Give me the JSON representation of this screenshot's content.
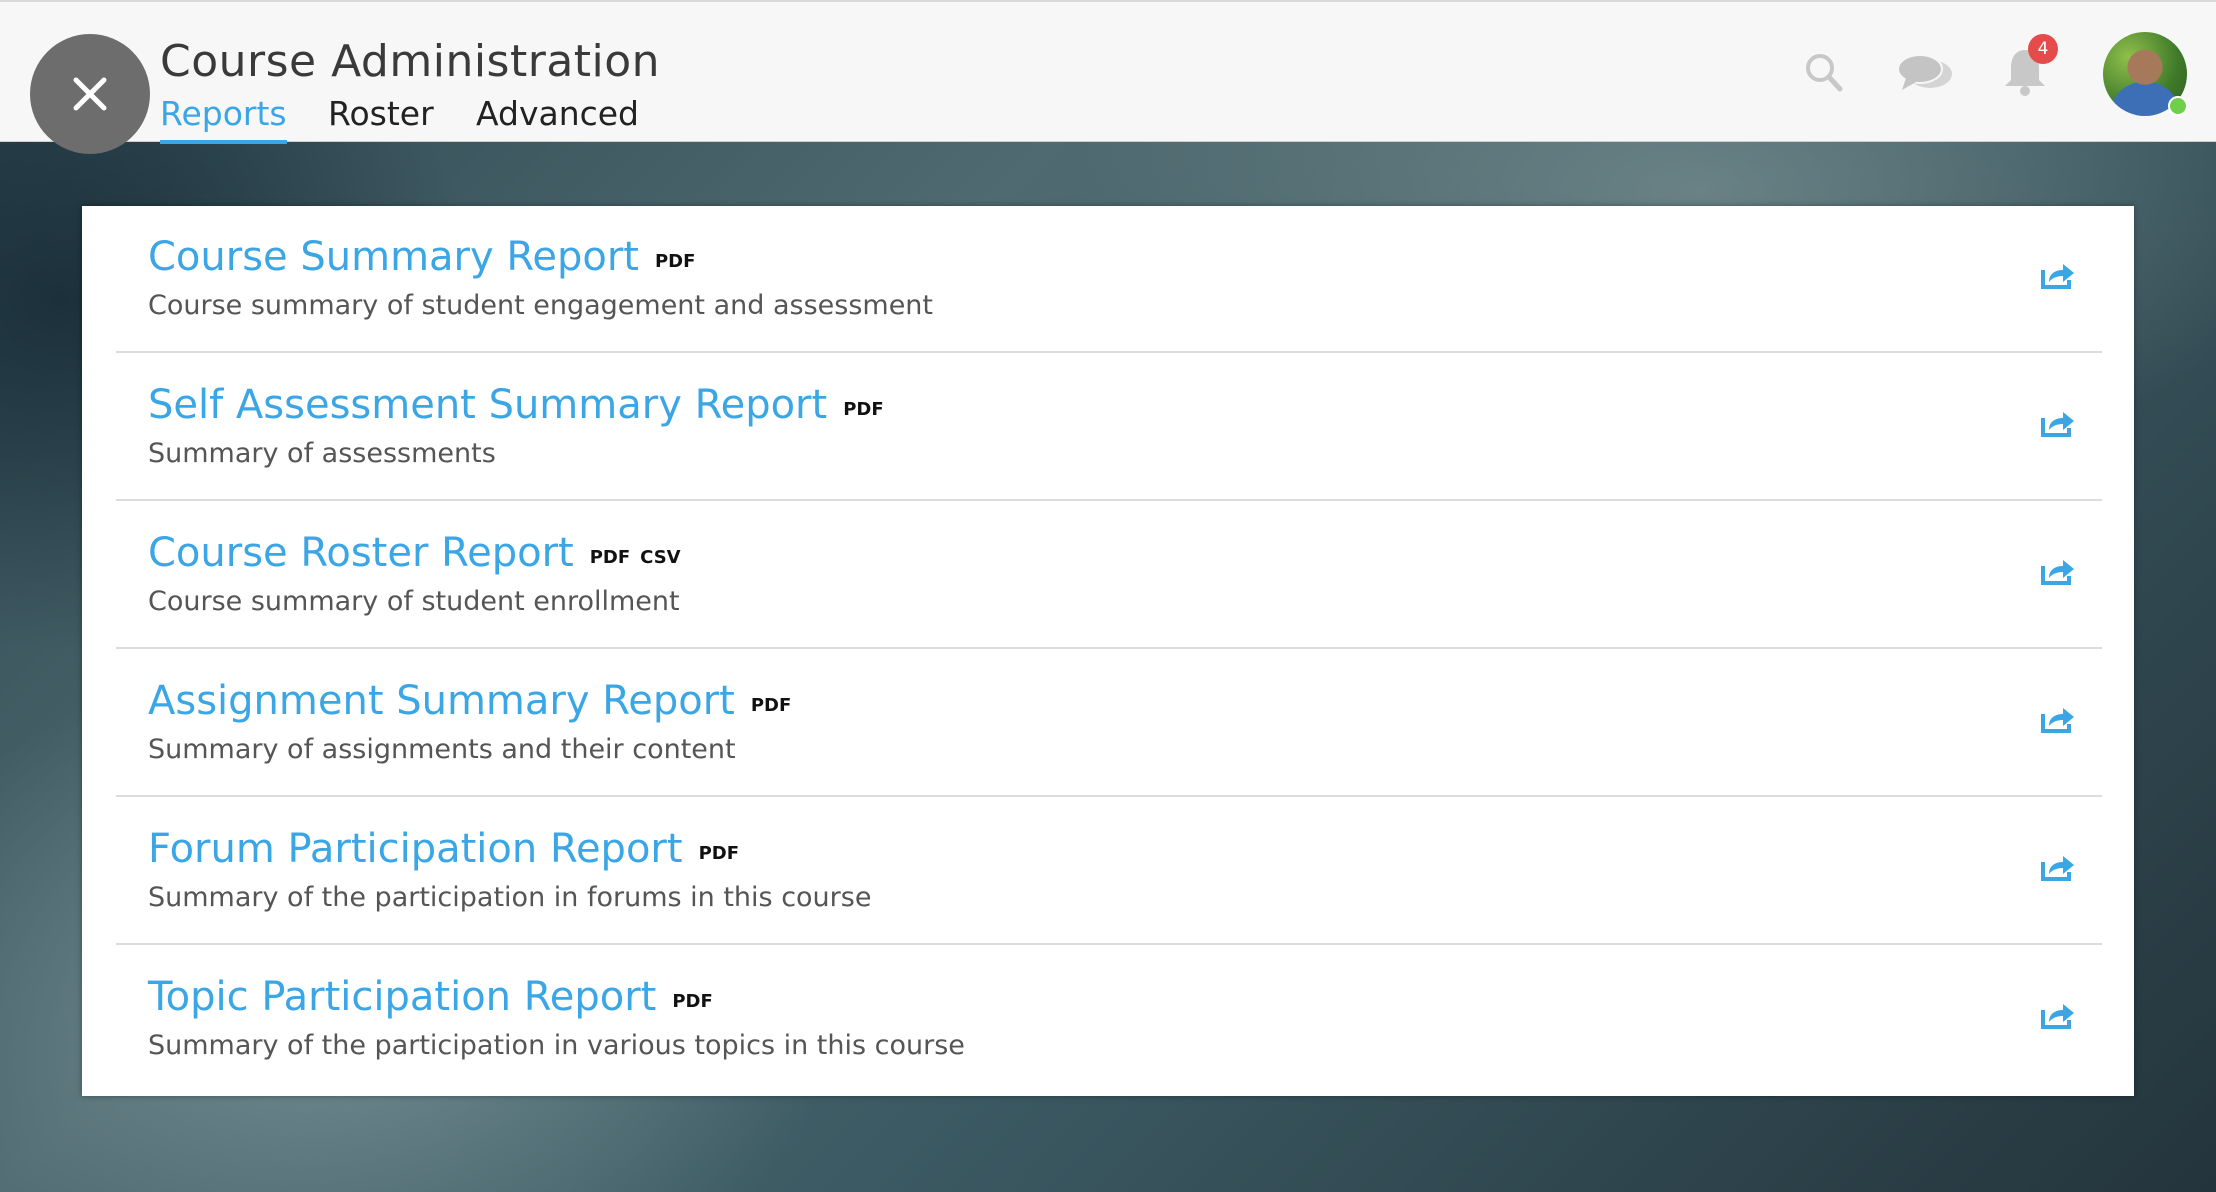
{
  "header": {
    "title": "Course Administration",
    "tabs": [
      {
        "label": "Reports",
        "active": true
      },
      {
        "label": "Roster",
        "active": false
      },
      {
        "label": "Advanced",
        "active": false
      }
    ],
    "icons": [
      "close-icon",
      "search-icon",
      "chat-icon",
      "bell-icon"
    ],
    "notification_count": "4",
    "accent_color": "#3aa6e6"
  },
  "reports": [
    {
      "title": "Course Summary Report",
      "formats": [
        "PDF"
      ],
      "description": "Course summary of student engagement and assessment"
    },
    {
      "title": "Self Assessment Summary Report",
      "formats": [
        "PDF"
      ],
      "description": "Summary of assessments"
    },
    {
      "title": "Course Roster Report",
      "formats": [
        "PDF",
        "CSV"
      ],
      "description": "Course summary of student enrollment"
    },
    {
      "title": "Assignment Summary Report",
      "formats": [
        "PDF"
      ],
      "description": "Summary of assignments and their content"
    },
    {
      "title": "Forum Participation Report",
      "formats": [
        "PDF"
      ],
      "description": "Summary of the participation in forums in this course"
    },
    {
      "title": "Topic Participation Report",
      "formats": [
        "PDF"
      ],
      "description": "Summary of the participation in various topics in this course"
    }
  ]
}
